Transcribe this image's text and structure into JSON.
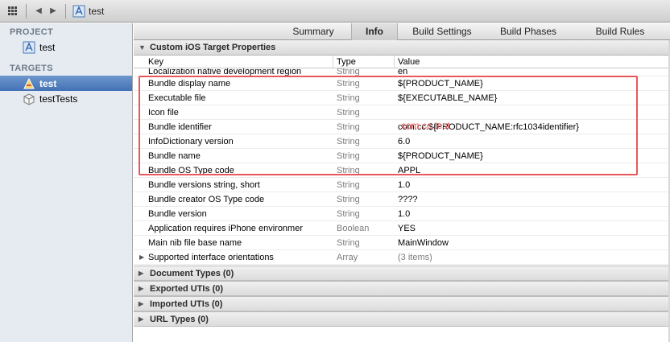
{
  "jumpbar": {
    "title": "test",
    "icons": [
      "grid-icon",
      "back-arrow-icon",
      "forward-arrow-icon",
      "project-icon"
    ]
  },
  "sidebar": {
    "project_header": "PROJECT",
    "project_item": "test",
    "targets_header": "TARGETS",
    "targets": [
      "test",
      "testTests"
    ]
  },
  "tabs": [
    "Summary",
    "Info",
    "Build Settings",
    "Build Phases",
    "Build Rules"
  ],
  "active_tab": "Info",
  "section": {
    "title": "Custom iOS Target Properties",
    "columns": {
      "key": "Key",
      "type": "Type",
      "value": "Value"
    },
    "rows": [
      {
        "key": "Localization native development region",
        "type": "String",
        "value": "en"
      },
      {
        "key": "Bundle display name",
        "type": "String",
        "value": "${PRODUCT_NAME}"
      },
      {
        "key": "Executable file",
        "type": "String",
        "value": "${EXECUTABLE_NAME}"
      },
      {
        "key": "Icon file",
        "type": "String",
        "value": ""
      },
      {
        "key": "Bundle identifier",
        "type": "String",
        "value": "com.cc.${PRODUCT_NAME:rfc1034identifier}"
      },
      {
        "key": "InfoDictionary version",
        "type": "String",
        "value": "6.0"
      },
      {
        "key": "Bundle name",
        "type": "String",
        "value": "${PRODUCT_NAME}"
      },
      {
        "key": "Bundle OS Type code",
        "type": "String",
        "value": "APPL"
      },
      {
        "key": "Bundle versions string, short",
        "type": "String",
        "value": "1.0"
      },
      {
        "key": "Bundle creator OS Type code",
        "type": "String",
        "value": "????"
      },
      {
        "key": "Bundle version",
        "type": "String",
        "value": "1.0"
      },
      {
        "key": "Application requires iPhone environmer",
        "type": "Boolean",
        "value": "YES"
      },
      {
        "key": "Main nib file base name",
        "type": "String",
        "value": "MainWindow"
      },
      {
        "key": "Supported interface orientations",
        "type": "Array",
        "value": "(3 items)"
      }
    ]
  },
  "annotation": "com.cc.test",
  "collapsed_sections": [
    "Document Types (0)",
    "Exported UTIs (0)",
    "Imported UTIs (0)",
    "URL Types (0)"
  ],
  "colors": {
    "selection": "#4371b5",
    "annotation": "#e8585a",
    "sidebar_bg": "#e6ebf2"
  }
}
